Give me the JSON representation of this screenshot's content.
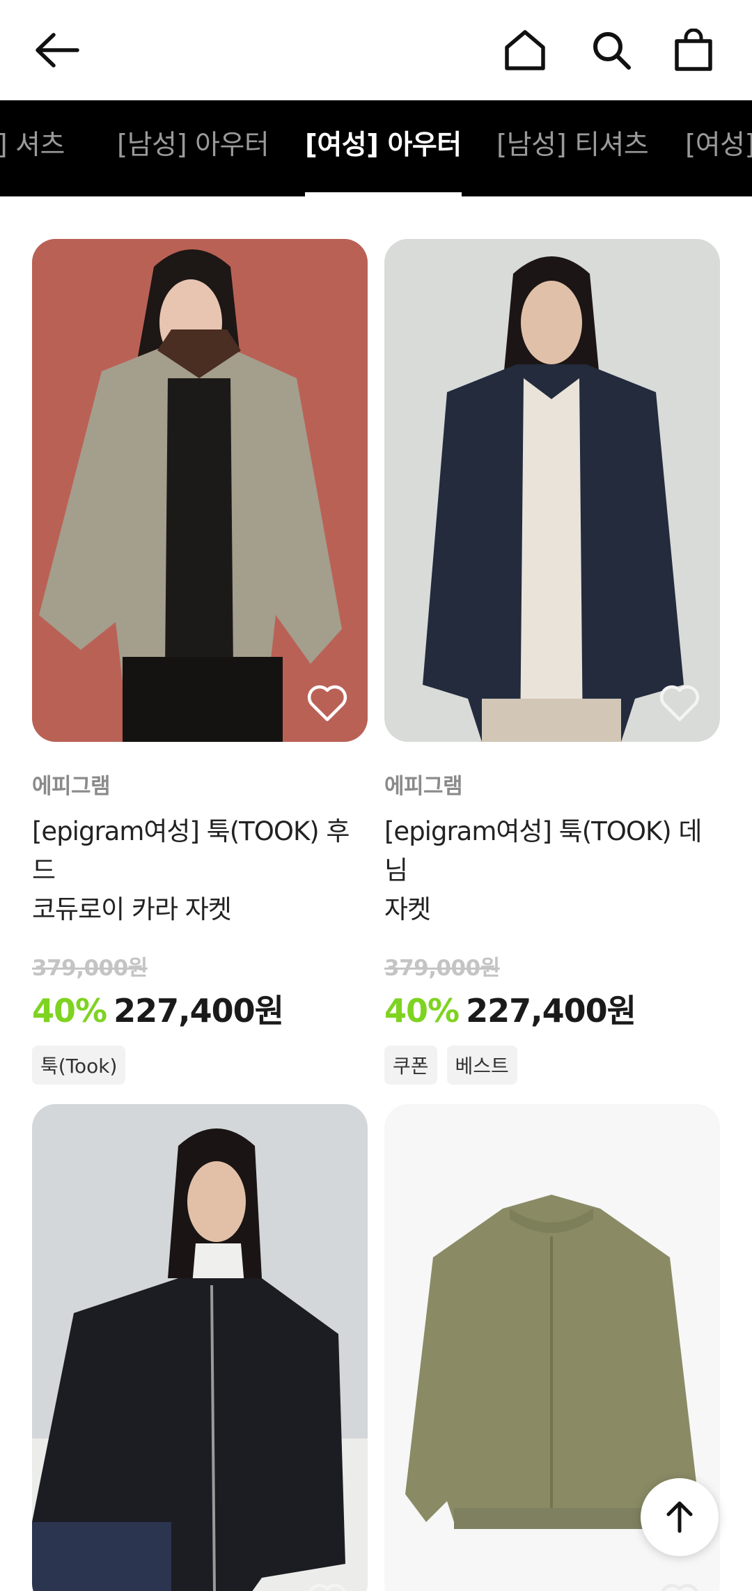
{
  "header": {
    "back_icon": "arrow-left-icon",
    "home_icon": "home-icon",
    "search_icon": "search-icon",
    "bag_icon": "shopping-bag-icon"
  },
  "tabs": [
    {
      "label": "[여성] 셔츠"
    },
    {
      "label": "[남성] 아우터"
    },
    {
      "label": "[여성] 아우터",
      "active": true
    },
    {
      "label": "[남성] 티셔츠"
    },
    {
      "label": "[여성] 티셔츠"
    }
  ],
  "section_heading": "[여성] 아우터",
  "products": [
    {
      "brand": "에피그램",
      "title_line1": "[epigram여성] 툭(TOOK) 후드",
      "title_line2": "코듀로이 카라 자켓",
      "original_price": "379,000원",
      "discount": "40%",
      "sale_price": "227,400원",
      "tags": [
        "툭(Took)"
      ]
    },
    {
      "brand": "에피그램",
      "title_line1": "[epigram여성] 툭(TOOK) 데님",
      "title_line2": "자켓",
      "original_price": "379,000원",
      "discount": "40%",
      "sale_price": "227,400원",
      "tags": [
        "쿠폰",
        "베스트"
      ]
    }
  ],
  "colors": {
    "accent_discount": "#7ed321",
    "tabbar_bg": "#000000",
    "tab_inactive": "#9a9a9a",
    "tab_active": "#ffffff"
  },
  "scroll_top_icon": "arrow-up-icon"
}
